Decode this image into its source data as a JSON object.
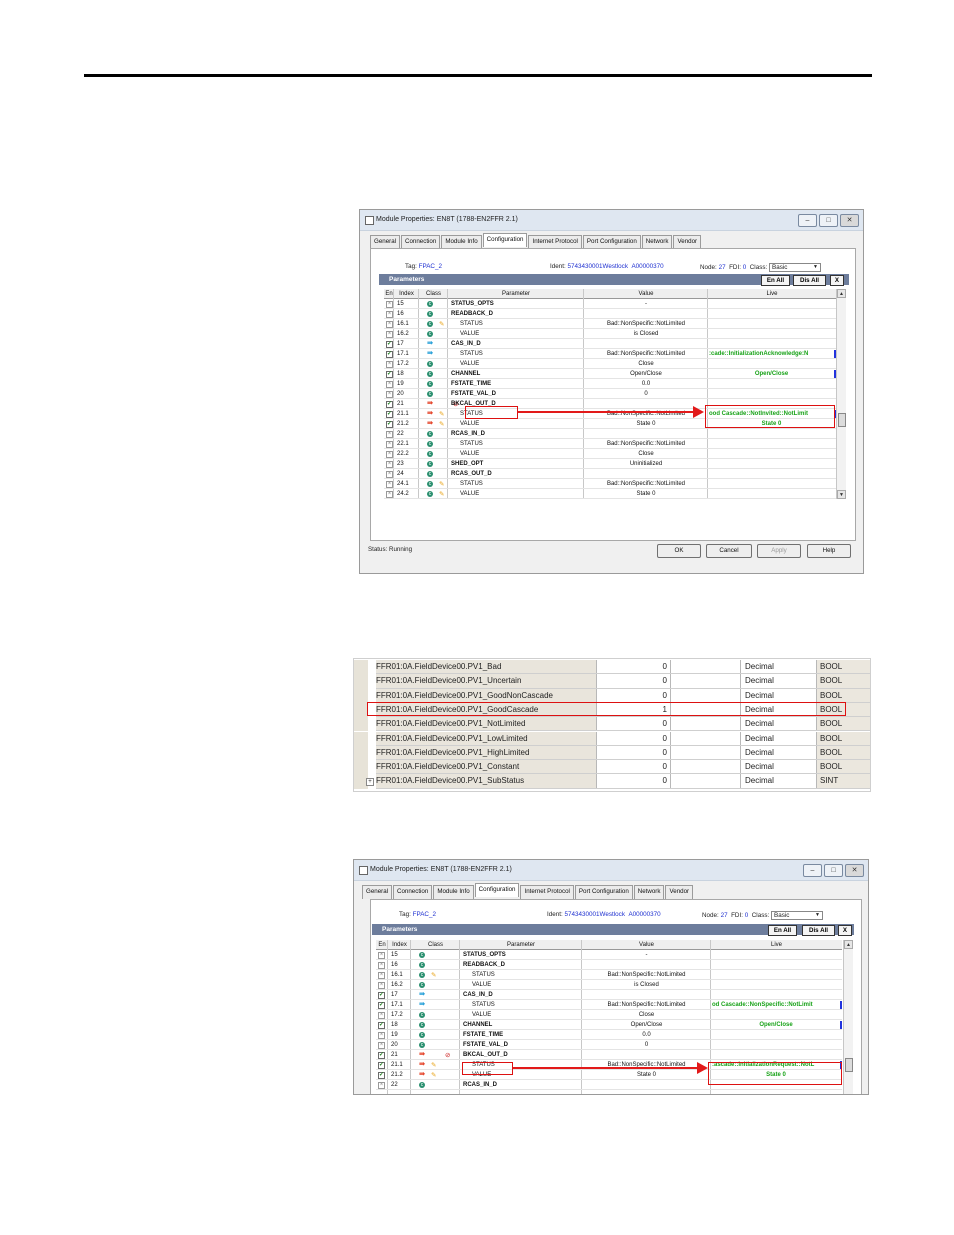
{
  "dialog1": {
    "title": "Module Properties: EN8T (1788-EN2FFR 2.1)",
    "tabs": [
      "General",
      "Connection",
      "Module Info",
      "Configuration",
      "Internet Protocol",
      "Port Configuration",
      "Network",
      "Vendor"
    ],
    "active_tab": "Configuration",
    "tag_label": "Tag:",
    "tag_value": "FPAC_2",
    "ident_label": "Ident:",
    "ident_value": "5743430001Westlock",
    "ident_code": "A00000370",
    "node_label": "Node:",
    "node_value": "27",
    "fdi_label": "FDI:",
    "fdi_value": "0",
    "class_label": "Class:",
    "class_value": "Basic",
    "params_title": "Parameters",
    "en_all": "En All",
    "dis_all": "Dis All",
    "close_x": "X",
    "columns": {
      "en": "En",
      "index": "Index",
      "class": "Class",
      "parameter": "Parameter",
      "value": "Value",
      "live": "Live"
    },
    "rows": [
      {
        "en": "x",
        "index": "15",
        "cls": "c",
        "pencil": false,
        "alarm": false,
        "param": "STATUS_OPTS",
        "value": "-",
        "live": "",
        "grp": true
      },
      {
        "en": "x",
        "index": "16",
        "cls": "c",
        "pencil": false,
        "alarm": false,
        "param": "READBACK_D",
        "value": "",
        "live": "",
        "grp": true
      },
      {
        "en": "x",
        "index": "16.1",
        "cls": "c",
        "pencil": true,
        "alarm": false,
        "param": "STATUS",
        "value": "Bad::NonSpecific::NotLimited",
        "live": "",
        "grp": false
      },
      {
        "en": "x",
        "index": "16.2",
        "cls": "c",
        "pencil": false,
        "alarm": false,
        "param": "VALUE",
        "value": "is Closed",
        "live": "",
        "grp": false
      },
      {
        "en": "v",
        "index": "17",
        "cls": "a",
        "pencil": false,
        "alarm": false,
        "param": "CAS_IN_D",
        "value": "",
        "live": "",
        "grp": true
      },
      {
        "en": "v",
        "index": "17.1",
        "cls": "a",
        "pencil": false,
        "alarm": false,
        "param": "STATUS",
        "value": "Bad::NonSpecific::NotLimited",
        "live": ":cade::InitializationAcknowledge:N",
        "grp": false
      },
      {
        "en": "x",
        "index": "17.2",
        "cls": "c",
        "pencil": false,
        "alarm": false,
        "param": "VALUE",
        "value": "Close",
        "live": "",
        "grp": false
      },
      {
        "en": "v",
        "index": "18",
        "cls": "c",
        "pencil": false,
        "alarm": false,
        "param": "CHANNEL",
        "value": "Open/Close",
        "live": "Open/Close",
        "grp": true
      },
      {
        "en": "x",
        "index": "19",
        "cls": "c",
        "pencil": false,
        "alarm": false,
        "param": "FSTATE_TIME",
        "value": "0.0",
        "live": "",
        "grp": true
      },
      {
        "en": "x",
        "index": "20",
        "cls": "c",
        "pencil": false,
        "alarm": false,
        "param": "FSTATE_VAL_D",
        "value": "0",
        "live": "",
        "grp": true
      },
      {
        "en": "v",
        "index": "21",
        "cls": "r",
        "pencil": false,
        "alarm": true,
        "param": "BKCAL_OUT_D",
        "value": "",
        "live": "",
        "grp": true
      },
      {
        "en": "v",
        "index": "21.1",
        "cls": "r",
        "pencil": true,
        "alarm": false,
        "param": "STATUS",
        "value": "Bad::NonSpecific::NotLimited",
        "live": "ood Cascade::NotInvited::NotLimit",
        "grp": false
      },
      {
        "en": "v",
        "index": "21.2",
        "cls": "r",
        "pencil": true,
        "alarm": false,
        "param": "VALUE",
        "value": "State 0",
        "live": "State 0",
        "grp": false
      },
      {
        "en": "x",
        "index": "22",
        "cls": "c",
        "pencil": false,
        "alarm": false,
        "param": "RCAS_IN_D",
        "value": "",
        "live": "",
        "grp": true
      },
      {
        "en": "x",
        "index": "22.1",
        "cls": "c",
        "pencil": false,
        "alarm": false,
        "param": "STATUS",
        "value": "Bad::NonSpecific::NotLimited",
        "live": "",
        "grp": false
      },
      {
        "en": "x",
        "index": "22.2",
        "cls": "c",
        "pencil": false,
        "alarm": false,
        "param": "VALUE",
        "value": "Close",
        "live": "",
        "grp": false
      },
      {
        "en": "x",
        "index": "23",
        "cls": "c",
        "pencil": false,
        "alarm": false,
        "param": "SHED_OPT",
        "value": "Uninitialized",
        "live": "",
        "grp": true
      },
      {
        "en": "x",
        "index": "24",
        "cls": "c",
        "pencil": false,
        "alarm": false,
        "param": "RCAS_OUT_D",
        "value": "",
        "live": "",
        "grp": true
      },
      {
        "en": "x",
        "index": "24.1",
        "cls": "c",
        "pencil": true,
        "alarm": false,
        "param": "STATUS",
        "value": "Bad::NonSpecific::NotLimited",
        "live": "",
        "grp": false
      },
      {
        "en": "x",
        "index": "24.2",
        "cls": "c",
        "pencil": true,
        "alarm": false,
        "param": "VALUE",
        "value": "State 0",
        "live": "",
        "grp": false
      }
    ],
    "status_label": "Status:",
    "status_value": "Running",
    "ok": "OK",
    "cancel": "Cancel",
    "apply": "Apply",
    "help": "Help"
  },
  "tags": [
    {
      "name": "FFR01:0A.FieldDevice00.PV1_Bad",
      "value": "0",
      "style": "Decimal",
      "type": "BOOL",
      "plus": false
    },
    {
      "name": "FFR01:0A.FieldDevice00.PV1_Uncertain",
      "value": "0",
      "style": "Decimal",
      "type": "BOOL",
      "plus": false
    },
    {
      "name": "FFR01:0A.FieldDevice00.PV1_GoodNonCascade",
      "value": "0",
      "style": "Decimal",
      "type": "BOOL",
      "plus": false
    },
    {
      "name": "FFR01:0A.FieldDevice00.PV1_GoodCascade",
      "value": "1",
      "style": "Decimal",
      "type": "BOOL",
      "plus": false
    },
    {
      "name": "FFR01:0A.FieldDevice00.PV1_NotLimited",
      "value": "0",
      "style": "Decimal",
      "type": "BOOL",
      "plus": false
    },
    {
      "name": "FFR01:0A.FieldDevice00.PV1_LowLimited",
      "value": "0",
      "style": "Decimal",
      "type": "BOOL",
      "plus": false
    },
    {
      "name": "FFR01:0A.FieldDevice00.PV1_HighLimited",
      "value": "0",
      "style": "Decimal",
      "type": "BOOL",
      "plus": false
    },
    {
      "name": "FFR01:0A.FieldDevice00.PV1_Constant",
      "value": "0",
      "style": "Decimal",
      "type": "BOOL",
      "plus": false
    },
    {
      "name": "FFR01:0A.FieldDevice00.PV1_SubStatus",
      "value": "0",
      "style": "Decimal",
      "type": "SINT",
      "plus": true
    }
  ],
  "dialog2": {
    "title": "Module Properties: EN8T (1788-EN2FFR 2.1)",
    "tabs": [
      "General",
      "Connection",
      "Module Info",
      "Configuration",
      "Internet Protocol",
      "Port Configuration",
      "Network",
      "Vendor"
    ],
    "active_tab": "Configuration",
    "tag_label": "Tag:",
    "tag_value": "FPAC_2",
    "ident_label": "Ident:",
    "ident_value": "5743430001Westlock",
    "ident_code": "A00000370",
    "node_label": "Node:",
    "node_value": "27",
    "fdi_label": "FDI:",
    "fdi_value": "0",
    "class_label": "Class:",
    "class_value": "Basic",
    "params_title": "Parameters",
    "en_all": "En All",
    "dis_all": "Dis All",
    "close_x": "X",
    "columns": {
      "en": "En",
      "index": "Index",
      "class": "Class",
      "parameter": "Parameter",
      "value": "Value",
      "live": "Live"
    },
    "rows": [
      {
        "en": "x",
        "index": "15",
        "cls": "c",
        "pencil": false,
        "alarm": false,
        "param": "STATUS_OPTS",
        "value": "-",
        "live": "",
        "grp": true
      },
      {
        "en": "x",
        "index": "16",
        "cls": "c",
        "pencil": false,
        "alarm": false,
        "param": "READBACK_D",
        "value": "",
        "live": "",
        "grp": true
      },
      {
        "en": "x",
        "index": "16.1",
        "cls": "c",
        "pencil": true,
        "alarm": false,
        "param": "STATUS",
        "value": "Bad::NonSpecific::NotLimited",
        "live": "",
        "grp": false
      },
      {
        "en": "x",
        "index": "16.2",
        "cls": "c",
        "pencil": false,
        "alarm": false,
        "param": "VALUE",
        "value": "is Closed",
        "live": "",
        "grp": false
      },
      {
        "en": "v",
        "index": "17",
        "cls": "a",
        "pencil": false,
        "alarm": false,
        "param": "CAS_IN_D",
        "value": "",
        "live": "",
        "grp": true
      },
      {
        "en": "v",
        "index": "17.1",
        "cls": "a",
        "pencil": false,
        "alarm": false,
        "param": "STATUS",
        "value": "Bad::NonSpecific::NotLimited",
        "live": "od Cascade::NonSpecific::NotLimit",
        "grp": false
      },
      {
        "en": "x",
        "index": "17.2",
        "cls": "c",
        "pencil": false,
        "alarm": false,
        "param": "VALUE",
        "value": "Close",
        "live": "",
        "grp": false
      },
      {
        "en": "v",
        "index": "18",
        "cls": "c",
        "pencil": false,
        "alarm": false,
        "param": "CHANNEL",
        "value": "Open/Close",
        "live": "Open/Close",
        "grp": true
      },
      {
        "en": "x",
        "index": "19",
        "cls": "c",
        "pencil": false,
        "alarm": false,
        "param": "FSTATE_TIME",
        "value": "0.0",
        "live": "",
        "grp": true
      },
      {
        "en": "x",
        "index": "20",
        "cls": "c",
        "pencil": false,
        "alarm": false,
        "param": "FSTATE_VAL_D",
        "value": "0",
        "live": "",
        "grp": true
      },
      {
        "en": "v",
        "index": "21",
        "cls": "r",
        "pencil": false,
        "alarm": true,
        "param": "BKCAL_OUT_D",
        "value": "",
        "live": "",
        "grp": true
      },
      {
        "en": "v",
        "index": "21.1",
        "cls": "r",
        "pencil": true,
        "alarm": false,
        "param": "STATUS",
        "value": "Bad::NonSpecific::NotLimited",
        "live": ":ascade::InitializationRequest::NotL",
        "grp": false
      },
      {
        "en": "v",
        "index": "21.2",
        "cls": "r",
        "pencil": true,
        "alarm": false,
        "param": "VALUE",
        "value": "State 0",
        "live": "State 0",
        "grp": false
      },
      {
        "en": "x",
        "index": "22",
        "cls": "c",
        "pencil": false,
        "alarm": false,
        "param": "RCAS_IN_D",
        "value": "",
        "live": "",
        "grp": true
      }
    ]
  }
}
